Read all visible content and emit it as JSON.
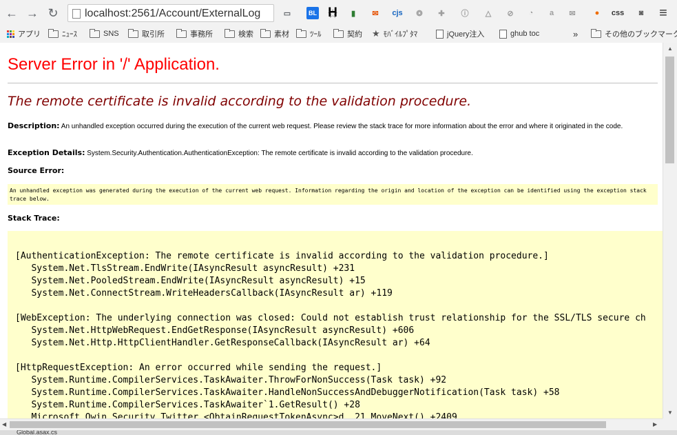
{
  "browser": {
    "url": "localhost:2561/Account/ExternalLog",
    "extensions": [
      {
        "name": "cast-icon",
        "glyph": "▭",
        "color": "#5f6368"
      },
      {
        "name": "bl-icon",
        "glyph": "BL",
        "color": "#1a73e8"
      },
      {
        "name": "h-icon",
        "glyph": "H",
        "color": "#000000"
      },
      {
        "name": "chart-ext-icon",
        "glyph": "▮",
        "color": "#2e7d32"
      },
      {
        "name": "mail-ext-icon",
        "glyph": "✉",
        "color": "#e65100"
      },
      {
        "name": "cjs-icon",
        "glyph": "cjs",
        "color": "#1565c0"
      },
      {
        "name": "leaf-icon",
        "glyph": "❂",
        "color": "#9e9e9e"
      },
      {
        "name": "puzzle-icon",
        "glyph": "✚",
        "color": "#9e9e9e"
      },
      {
        "name": "info-ext-icon",
        "glyph": "ⓘ",
        "color": "#9e9e9e"
      },
      {
        "name": "drive-icon",
        "glyph": "△",
        "color": "#9e9e9e"
      },
      {
        "name": "compass-icon",
        "glyph": "⊘",
        "color": "#9e9e9e"
      },
      {
        "name": "rss-icon",
        "glyph": "◔",
        "color": "#9e9e9e"
      },
      {
        "name": "a-icon",
        "glyph": "a",
        "color": "#9e9e9e"
      },
      {
        "name": "envelope-icon",
        "glyph": "✉",
        "color": "#9e9e9e"
      },
      {
        "name": "fox-icon",
        "glyph": "●",
        "color": "#ef6c00"
      },
      {
        "name": "css-icon",
        "glyph": "css",
        "color": "#333333"
      },
      {
        "name": "camera-icon",
        "glyph": "◙",
        "color": "#555555"
      },
      {
        "name": "menu-icon",
        "glyph": "≡",
        "color": "#333333"
      }
    ]
  },
  "bookmarks": {
    "items": [
      {
        "label": "アプリ",
        "type": "apps"
      },
      {
        "label": "ﾆｭｰｽ",
        "type": "folder"
      },
      {
        "label": "SNS",
        "type": "folder"
      },
      {
        "label": "取引所",
        "type": "folder"
      },
      {
        "label": "事務所",
        "type": "folder"
      },
      {
        "label": "検索",
        "type": "folder"
      },
      {
        "label": "素材",
        "type": "folder"
      },
      {
        "label": "ﾂｰﾙ",
        "type": "folder"
      },
      {
        "label": "契約",
        "type": "folder"
      },
      {
        "label": "ﾓﾊﾞｲﾙﾌﾟﾀﾏ",
        "type": "star"
      },
      {
        "label": "jQuery注入",
        "type": "page"
      },
      {
        "label": "ghub toc",
        "type": "page"
      }
    ],
    "overflow": "»",
    "other": "その他のブックマーク"
  },
  "page": {
    "title": "Server Error in '/' Application.",
    "subtitle": "The remote certificate is invalid according to the validation procedure.",
    "description_label": "Description:",
    "description_text": "An unhandled exception occurred during the execution of the current web request. Please review the stack trace for more information about the error and where it originated in the code.",
    "exception_label": "Exception Details:",
    "exception_text": "System.Security.Authentication.AuthenticationException: The remote certificate is invalid according to the validation procedure.",
    "source_error_label": "Source Error:",
    "source_error_text": "An unhandled exception was generated during the execution of the current web request. Information regarding the origin and location of the exception can be identified using the exception stack trace below.",
    "stack_trace_label": "Stack Trace:",
    "stack_lines": [
      "[AuthenticationException: The remote certificate is invalid according to the validation procedure.]",
      "   System.Net.TlsStream.EndWrite(IAsyncResult asyncResult) +231",
      "   System.Net.PooledStream.EndWrite(IAsyncResult asyncResult) +15",
      "   System.Net.ConnectStream.WriteHeadersCallback(IAsyncResult ar) +119",
      "",
      "[WebException: The underlying connection was closed: Could not establish trust relationship for the SSL/TLS secure ch",
      "   System.Net.HttpWebRequest.EndGetResponse(IAsyncResult asyncResult) +606",
      "   System.Net.Http.HttpClientHandler.GetResponseCallback(IAsyncResult ar) +64",
      "",
      "[HttpRequestException: An error occurred while sending the request.]",
      "   System.Runtime.CompilerServices.TaskAwaiter.ThrowForNonSuccess(Task task) +92",
      "   System.Runtime.CompilerServices.TaskAwaiter.HandleNonSuccessAndDebuggerNotification(Task task) +58",
      "   System.Runtime.CompilerServices.TaskAwaiter`1.GetResult() +28",
      "   Microsoft.Owin.Security.Twitter.<ObtainRequestTokenAsync>d__21.MoveNext() +2409"
    ]
  },
  "taskbar": {
    "tab": "Global.asax.cs"
  }
}
